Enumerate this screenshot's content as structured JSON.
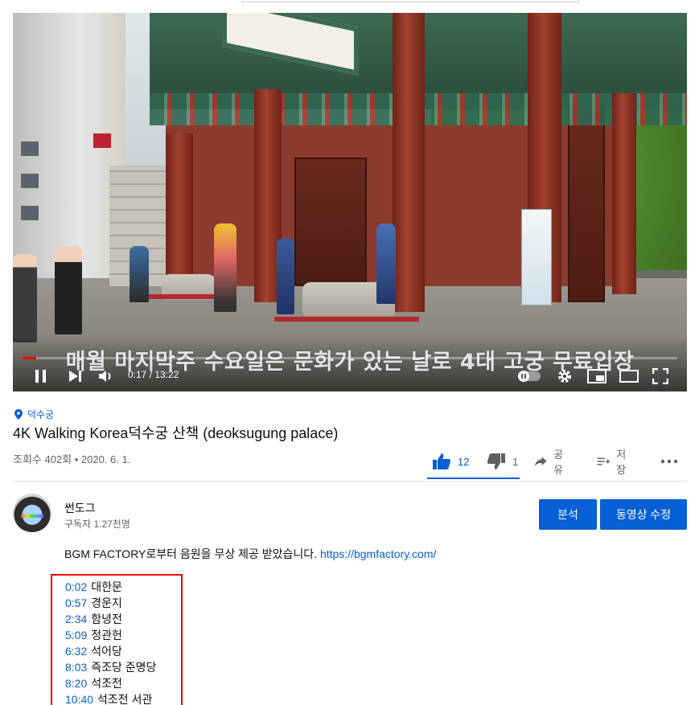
{
  "player": {
    "subtitle": "매월 마지막주 수요일은 문화가 있는 날로 4대 고궁 무료입장",
    "time": "0:17 / 13:22",
    "progress": 0.021
  },
  "video": {
    "location": "덕수궁",
    "title": "4K Walking Korea덕수궁 산책 (deoksugung palace)",
    "meta": "조회수 402회 • 2020. 6. 1."
  },
  "actions": {
    "like_count": "12",
    "dislike_count": "1",
    "share_label": "공유",
    "save_label": "저장"
  },
  "channel": {
    "name": "썬도그",
    "subscribers": "구독자 1.27천명",
    "analytics_label": "분석",
    "edit_label": "동영상 수정"
  },
  "description": {
    "text": "BGM FACTORY로부터 음원을 무상 제공 받았습니다.",
    "link": "https://bgmfactory.com/"
  },
  "chapters": [
    {
      "time": "0:02",
      "label": "대한문"
    },
    {
      "time": "0:57",
      "label": "경운지"
    },
    {
      "time": "2:34",
      "label": "함녕전"
    },
    {
      "time": "5:09",
      "label": "정관헌"
    },
    {
      "time": "6:32",
      "label": "석어당"
    },
    {
      "time": "8:03",
      "label": "즉조당 준명당"
    },
    {
      "time": "8:20",
      "label": "석조전"
    },
    {
      "time": "10:40",
      "label": "석조전 서관"
    }
  ],
  "colors": {
    "accent": "#065fd4",
    "progress": "#ff0000",
    "highlight_border": "#ee0000"
  }
}
